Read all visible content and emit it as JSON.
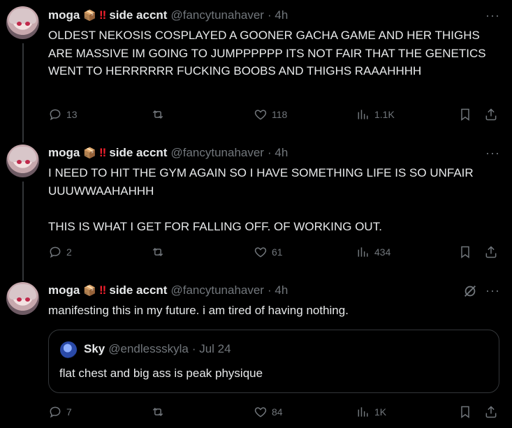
{
  "tweets": [
    {
      "display_name": "moga",
      "emoji": "📦",
      "bang": "‼",
      "name_suffix": "side accnt",
      "handle": "@fancytunahaver",
      "time": "· 4h",
      "text": "OLDEST NEKOSIS COSPLAYED A GOONER GACHA GAME AND HER THIGHS ARE MASSIVE IM GOING TO JUMPPPPPP ITS NOT FAIR THAT THE GENETICS WENT TO HERRRRRR FUCKING BOOBS AND THIGHS RAAAHHHH",
      "replies": "13",
      "retweets": "",
      "likes": "118",
      "views": "1.1K"
    },
    {
      "display_name": "moga",
      "emoji": "📦",
      "bang": "‼",
      "name_suffix": "side accnt",
      "handle": "@fancytunahaver",
      "time": "· 4h",
      "text": "I NEED TO HIT THE GYM AGAIN SO I HAVE SOMETHING LIFE IS SO UNFAIR UUUWWAAHAHHH\n\nTHIS IS WHAT I GET FOR FALLING OFF. OF WORKING OUT.",
      "replies": "2",
      "retweets": "",
      "likes": "61",
      "views": "434"
    },
    {
      "display_name": "moga",
      "emoji": "📦",
      "bang": "‼",
      "name_suffix": "side accnt",
      "handle": "@fancytunahaver",
      "time": "· 4h",
      "text": "manifesting this in my future. i am tired of having nothing.",
      "replies": "7",
      "retweets": "",
      "likes": "84",
      "views": "1K",
      "quote": {
        "display_name": "Sky",
        "handle": "@endlessskyla",
        "time": "· Jul 24",
        "text": "flat chest and big ass is peak physique"
      }
    }
  ],
  "more_icon": "···",
  "icons": [
    "reply-icon",
    "retweet-icon",
    "like-icon",
    "views-icon",
    "bookmark-icon",
    "share-icon",
    "grok-icon",
    "more-icon"
  ],
  "colors": {
    "background": "#000000",
    "text": "#e7e9ea",
    "muted": "#71767b",
    "border": "#333639",
    "alert": "#f4212e"
  }
}
